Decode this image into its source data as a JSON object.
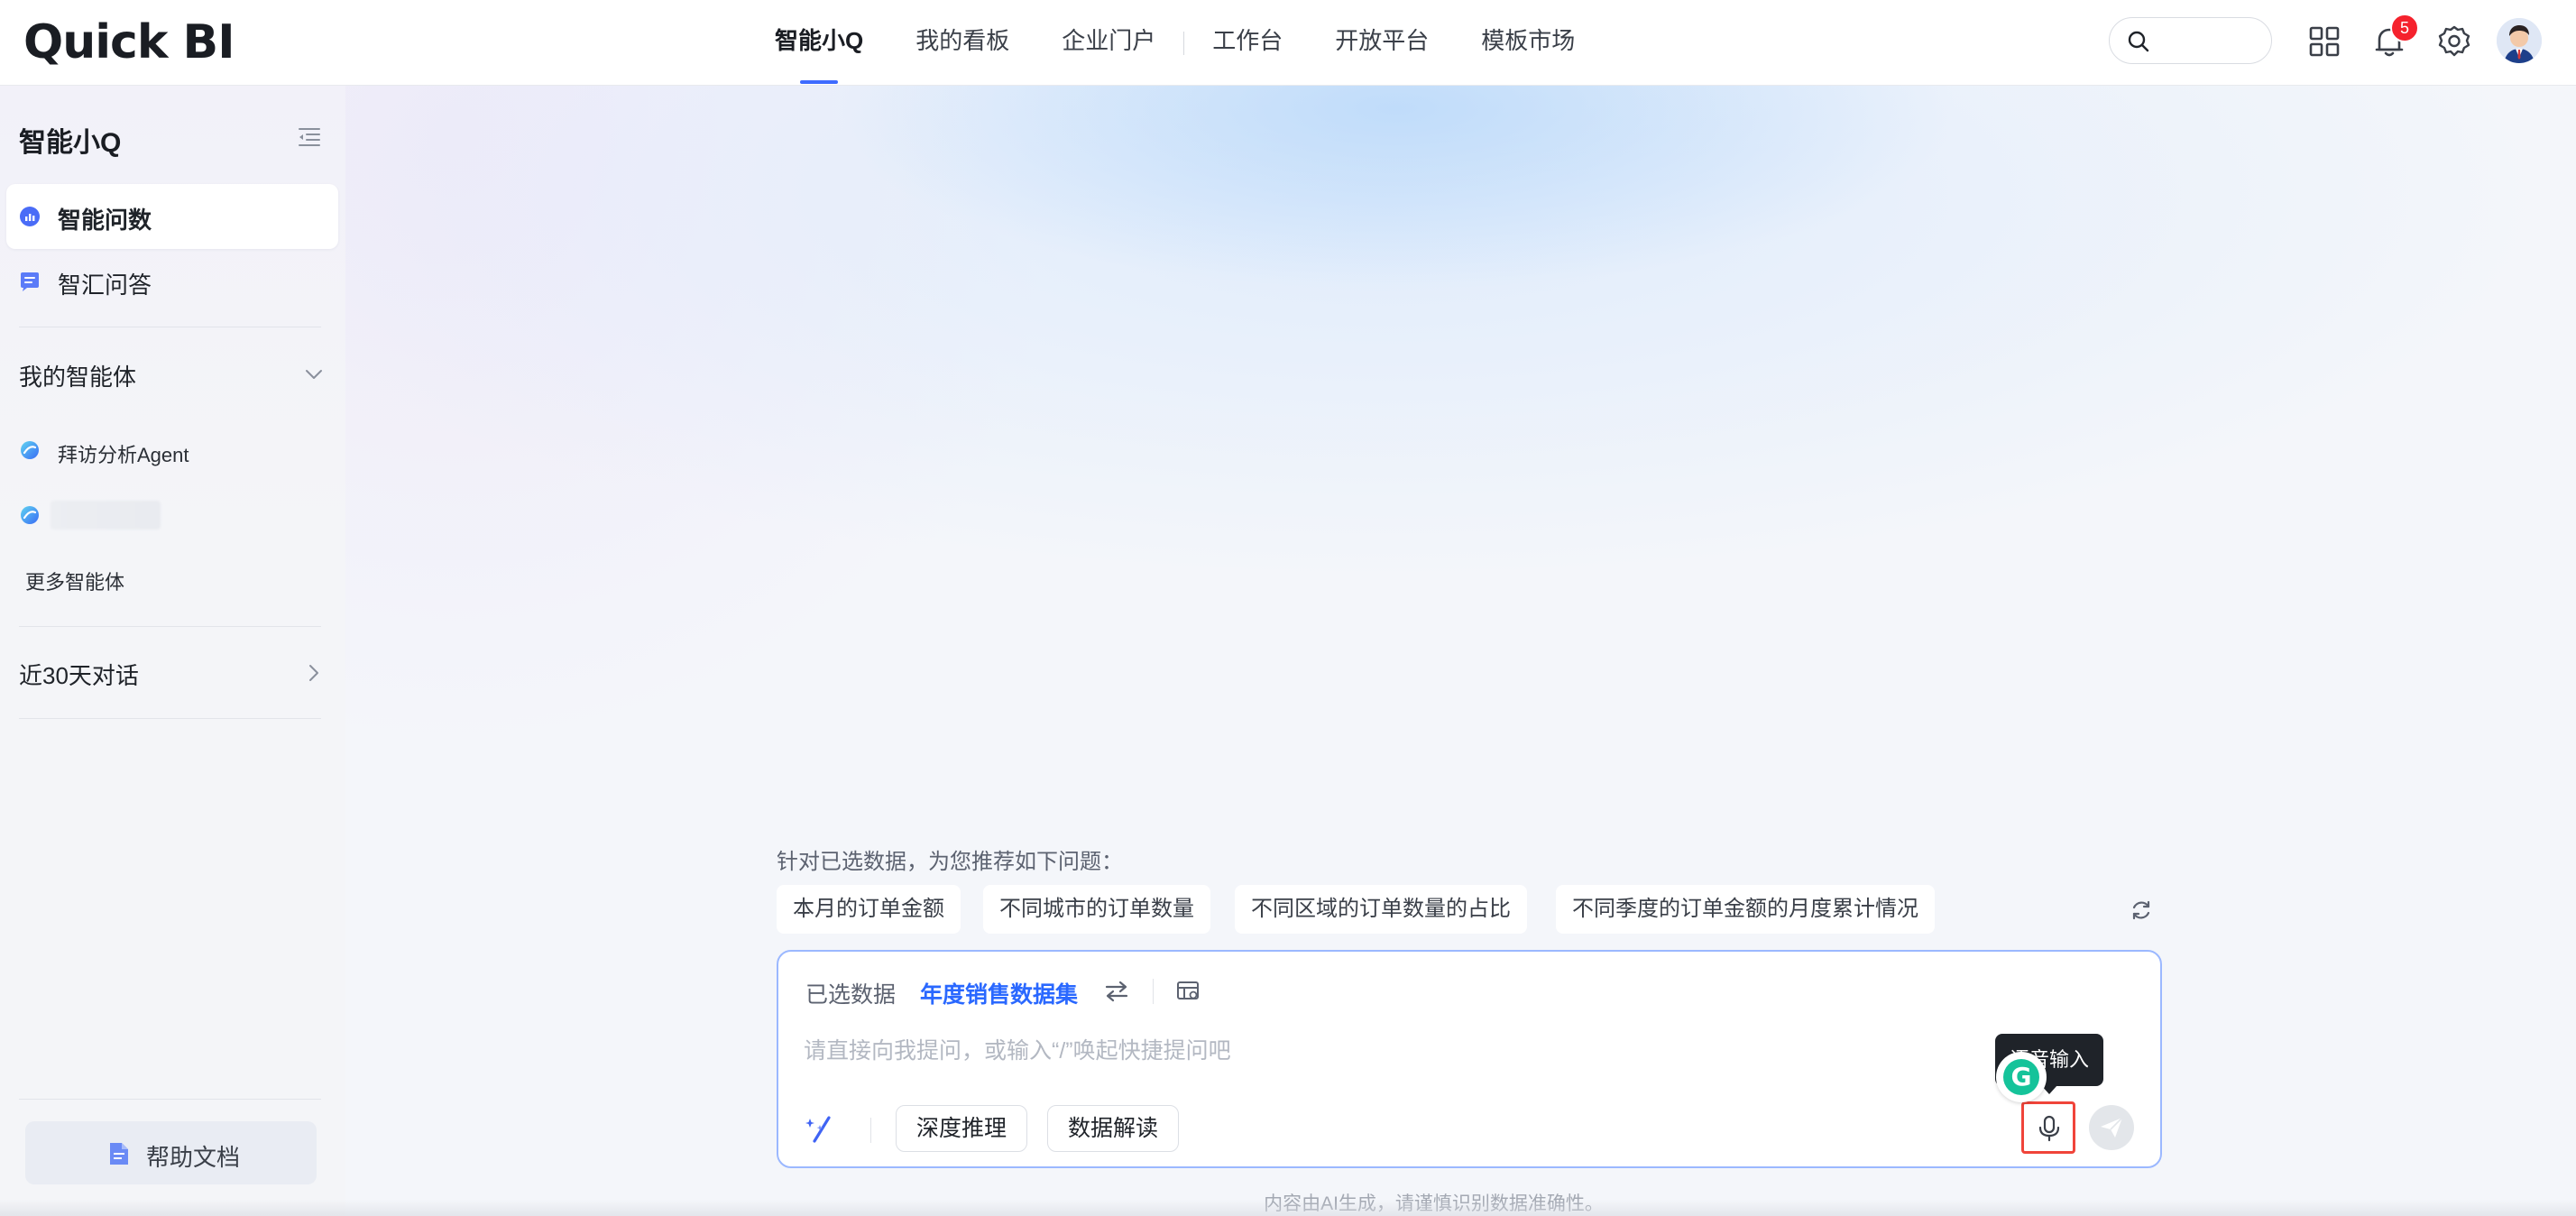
{
  "app": {
    "logo_text": "Quick BI"
  },
  "nav": {
    "items": [
      {
        "label": "智能小Q",
        "active": true
      },
      {
        "label": "我的看板"
      },
      {
        "label": "企业门户"
      },
      {
        "label": "工作台"
      },
      {
        "label": "开放平台"
      },
      {
        "label": "模板市场"
      }
    ]
  },
  "header": {
    "search_placeholder": "",
    "notification_count": "5",
    "icons": [
      "search-icon",
      "apps-grid-icon",
      "bell-icon",
      "gear-icon",
      "avatar"
    ]
  },
  "sidebar": {
    "title": "智能小Q",
    "items": [
      {
        "label": "智能问数",
        "icon": "chart-bubble-icon",
        "active": true
      },
      {
        "label": "智汇问答",
        "icon": "chat-list-icon"
      }
    ],
    "my_agents": {
      "label": "我的智能体",
      "items": [
        {
          "label": "拜访分析Agent",
          "icon": "agent-sphere-icon"
        },
        {
          "label": "",
          "icon": "agent-sphere-icon"
        }
      ],
      "more_label": "更多智能体"
    },
    "recent": {
      "label": "近30天对话"
    },
    "help": {
      "label": "帮助文档",
      "icon": "document-icon"
    }
  },
  "main": {
    "suggest_title": "针对已选数据，为您推荐如下问题：",
    "suggestions": [
      "本月的订单金额",
      "不同城市的订单数量",
      "不同区域的订单数量的占比",
      "不同季度的订单金额的月度累计情况"
    ],
    "input": {
      "selected_label": "已选数据",
      "selected_value": "年度销售数据集",
      "placeholder": "请直接向我提问，或输入“/”唤起快捷提问吧",
      "value": "",
      "modes": [
        "深度推理",
        "数据解读"
      ],
      "tooltip": "语音输入"
    },
    "footer_note": "内容由AI生成，请谨慎识别数据准确性。"
  },
  "colors": {
    "accent": "#2a68ff",
    "nav_underline": "#3e6bff",
    "badge": "#f5222d",
    "mic_highlight": "#f0443a",
    "input_border": "#9bb8ff"
  }
}
